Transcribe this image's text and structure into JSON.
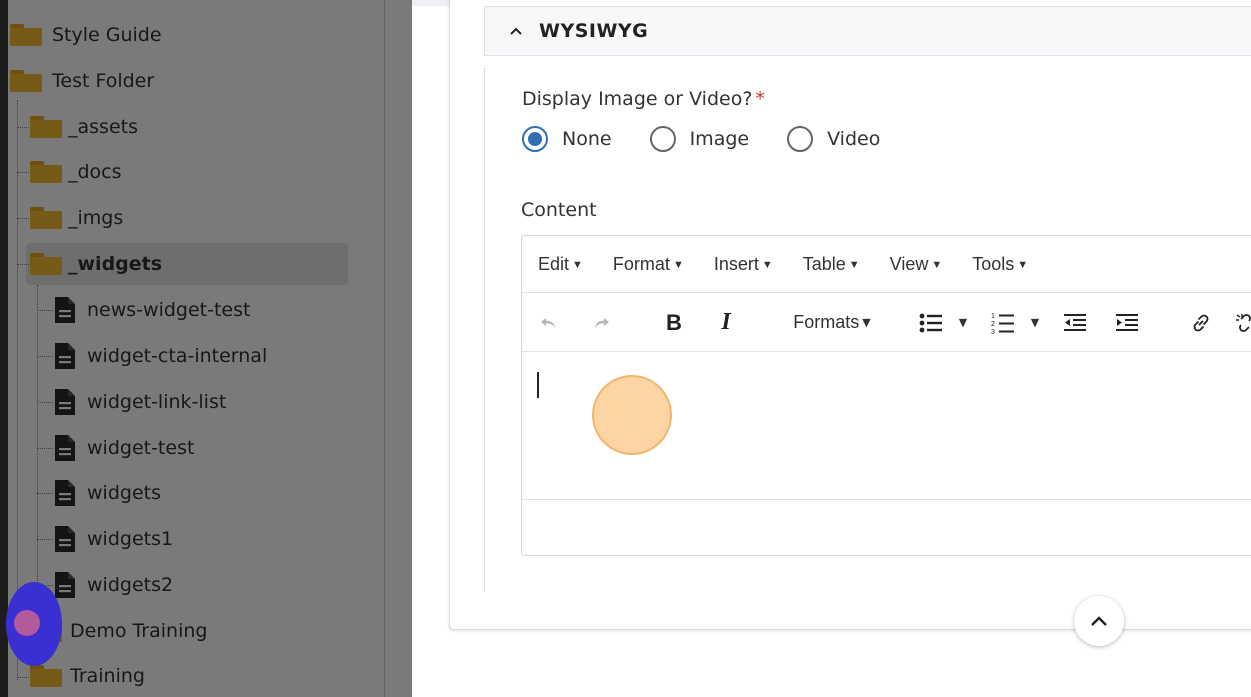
{
  "sidebar": {
    "items": [
      {
        "label": "Style Guide",
        "type": "folder"
      },
      {
        "label": "Test Folder",
        "type": "folder"
      },
      {
        "label": "_assets",
        "type": "folder"
      },
      {
        "label": "_docs",
        "type": "folder"
      },
      {
        "label": "_imgs",
        "type": "folder"
      },
      {
        "label": "_widgets",
        "type": "folder",
        "selected": true
      },
      {
        "label": "news-widget-test",
        "type": "page"
      },
      {
        "label": "widget-cta-internal",
        "type": "page"
      },
      {
        "label": "widget-link-list",
        "type": "page"
      },
      {
        "label": "widget-test",
        "type": "page"
      },
      {
        "label": "widgets",
        "type": "page"
      },
      {
        "label": "widgets1",
        "type": "page"
      },
      {
        "label": "widgets2",
        "type": "page"
      },
      {
        "label": "Demo Training",
        "type": "folder"
      },
      {
        "label": "Training",
        "type": "folder"
      }
    ]
  },
  "section": {
    "title": "WYSIWYG"
  },
  "display_field": {
    "label": "Display Image or Video?",
    "required_mark": "*",
    "options": [
      "None",
      "Image",
      "Video"
    ],
    "selected": "None"
  },
  "content_field": {
    "label": "Content"
  },
  "editor": {
    "menus": [
      "Edit",
      "Format",
      "Insert",
      "Table",
      "View",
      "Tools"
    ],
    "toolbar": {
      "bold": "B",
      "italic": "I",
      "formats": "Formats"
    },
    "icons": [
      "undo-icon",
      "redo-icon",
      "bullet-list-icon",
      "numbered-list-icon",
      "outdent-icon",
      "indent-icon",
      "link-icon",
      "unlink-icon"
    ]
  },
  "colors": {
    "radio_selected": "#2f6fb2",
    "folder": "#f5bd34",
    "required": "#c0392b",
    "click_marker": "#fdcd94",
    "cursor_marker": "#3a2fd0"
  }
}
